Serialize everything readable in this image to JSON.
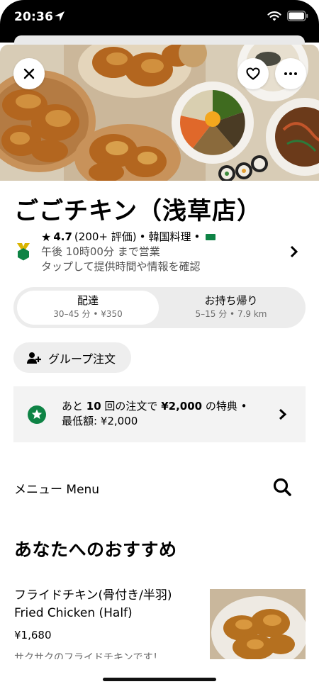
{
  "status_bar": {
    "time": "20:36"
  },
  "header": {
    "close_icon": "close-icon",
    "favorite_icon": "heart-icon",
    "more_icon": "more-icon"
  },
  "store": {
    "name": "ごごチキン（浅草店）",
    "star": "★",
    "rating": "4.7",
    "reviews": "(200+ 評価)",
    "separator": "•",
    "cuisine": "韓国料理",
    "hours": "午後 10時00分 まで営業",
    "hint": "タップして提供時間や情報を確認"
  },
  "delivery_toggle": {
    "options": [
      {
        "label": "配達",
        "detail": "30–45 分 • ¥350"
      },
      {
        "label": "お持ち帰り",
        "detail": "5–15 分 • 7.9 km"
      }
    ],
    "selected": "配達"
  },
  "group_order": {
    "label": "グループ注文"
  },
  "promo": {
    "prefix": "あと ",
    "count": "10",
    "middle": " 回の注文で ",
    "amount": "¥2,000",
    "suffix": " の特典 •",
    "line2": "最低額: ¥2,000"
  },
  "menu": {
    "title": "メニュー Menu",
    "section_title": "あなたへのおすすめ",
    "items": [
      {
        "name": "フライドチキン(骨付き/半羽)   Fried Chicken (Half)",
        "price": "¥1,680",
        "description": "サクサクのフライドチキンです！"
      }
    ]
  },
  "colors": {
    "accent_green": "#0e8345",
    "badge_yellow": "#d9b400",
    "pill_bg": "#ececec",
    "promo_bg": "#f3f3f3"
  }
}
